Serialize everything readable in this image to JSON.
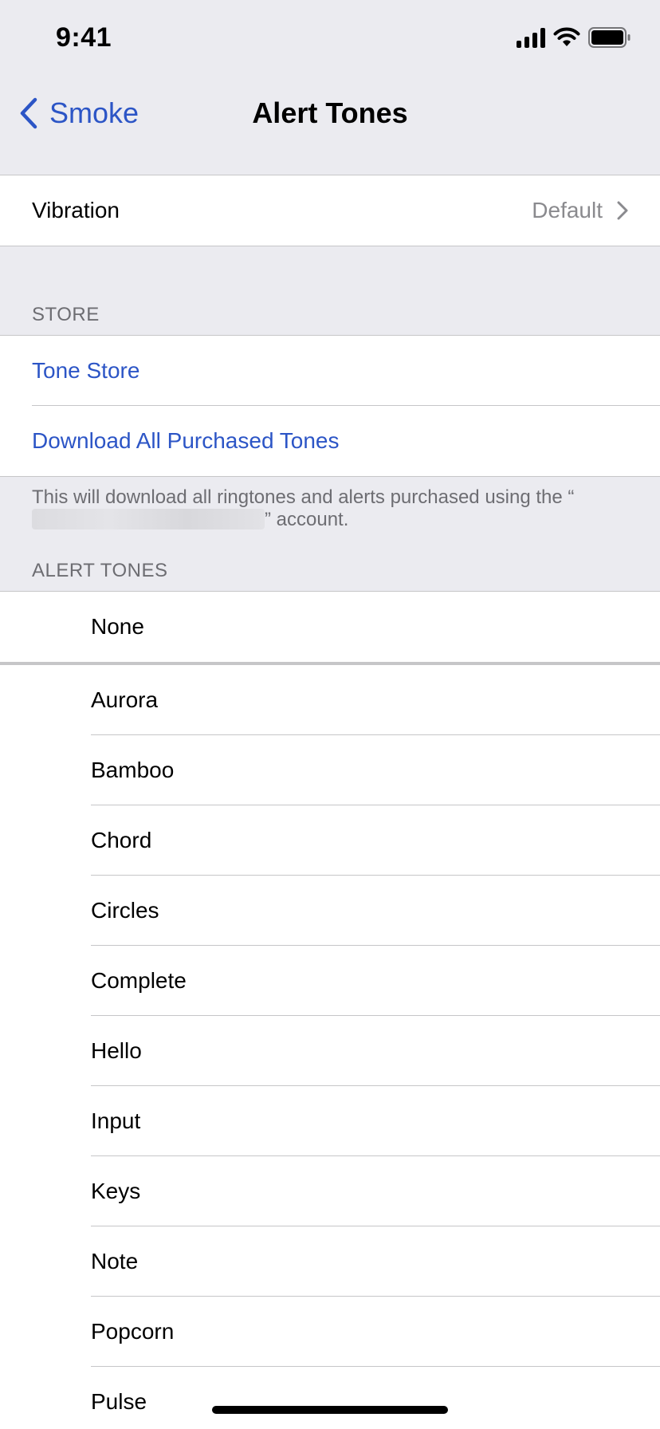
{
  "status_bar": {
    "time": "9:41"
  },
  "nav": {
    "back_label": "Smoke",
    "title": "Alert Tones"
  },
  "vibration": {
    "label": "Vibration",
    "value": "Default"
  },
  "store": {
    "header": "STORE",
    "items": [
      "Tone Store",
      "Download All Purchased Tones"
    ],
    "note_before": "This will download all ringtones and alerts purchased using the “",
    "note_after": "” account."
  },
  "alert_tones": {
    "header": "ALERT TONES",
    "none_label": "None",
    "tones": [
      "Aurora",
      "Bamboo",
      "Chord",
      "Circles",
      "Complete",
      "Hello",
      "Input",
      "Keys",
      "Note",
      "Popcorn",
      "Pulse"
    ]
  },
  "colors": {
    "accent": "#2c55c6",
    "background": "#ebebf0",
    "separator": "#c6c6c8",
    "secondary_text": "#6d6d72"
  }
}
